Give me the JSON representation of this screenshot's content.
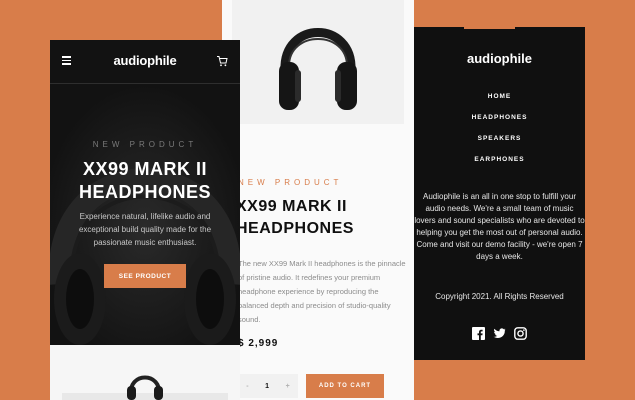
{
  "colors": {
    "accent": "#d87d4a",
    "dark": "#101010",
    "light": "#fafafa"
  },
  "product_detail": {
    "overline": "NEW PRODUCT",
    "title_line1": "XX99 MARK II",
    "title_line2": "HEADPHONES",
    "description": "The new XX99 Mark II headphones is the pinnacle of pristine audio. It redefines your premium headphone experience by reproducing the balanced depth and precision of studio-quality sound.",
    "price": "$ 2,999",
    "quantity": {
      "minus": "-",
      "value": "1",
      "plus": "+"
    },
    "add_to_cart": "ADD TO CART"
  },
  "mobile_home": {
    "logo": "audiophile",
    "menu_icon": "hamburger-icon",
    "cart_icon": "cart-icon",
    "overline": "NEW PRODUCT",
    "title_line1": "XX99 MARK II",
    "title_line2": "HEADPHONES",
    "description": "Experience natural, lifelike audio and exceptional build quality made for the passionate music enthusiast.",
    "cta": "SEE PRODUCT"
  },
  "footer": {
    "logo": "audiophile",
    "links": [
      "HOME",
      "HEADPHONES",
      "SPEAKERS",
      "EARPHONES"
    ],
    "about": "Audiophile is an all in one stop to fulfill your audio needs. We're a small team of music lovers and sound specialists who are devoted to helping you get the most out of personal audio. Come and visit our demo facility - we're open 7 days a week.",
    "copyright": "Copyright 2021. All Rights Reserved",
    "socials": [
      "facebook-icon",
      "twitter-icon",
      "instagram-icon"
    ]
  }
}
